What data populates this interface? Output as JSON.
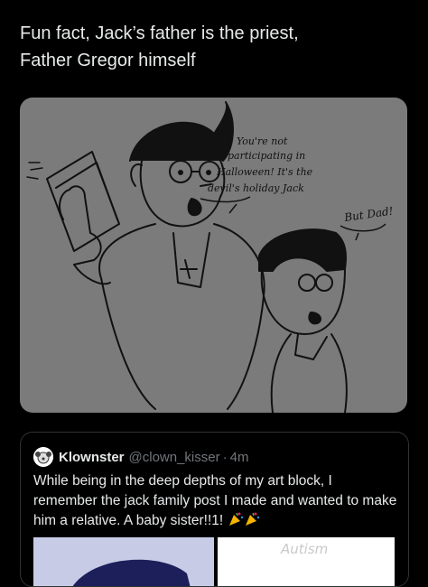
{
  "tweet": {
    "text": "Fun fact, Jack’s father is the priest,\nFather Gregor himself"
  },
  "media": {
    "speech_bubble_lines": [
      "You're not",
      "participating in",
      "Halloween! It's the",
      "devil's holiday Jack"
    ],
    "reply_bubble": "But Dad!"
  },
  "quote": {
    "display_name": "Klownster",
    "handle": "@clown_kisser",
    "separator": "·",
    "time": "4m",
    "text": "While being in the deep depths of my art block, I remember the jack family post I made and wanted to make him a relative. A baby sister!!1!",
    "media_right_label": "Autism"
  },
  "colors": {
    "background": "#000000",
    "text_primary": "#e7e9ea",
    "text_secondary": "#71767b",
    "border": "#2f3336",
    "drawing_bg": "#7b7b7b"
  },
  "icons": [
    "party-popper-icon",
    "party-popper-icon"
  ]
}
